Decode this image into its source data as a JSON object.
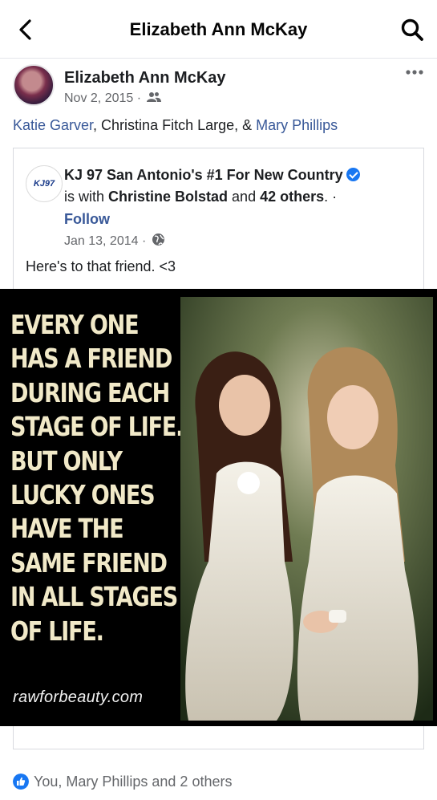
{
  "topbar": {
    "title": "Elizabeth Ann McKay"
  },
  "post": {
    "author": "Elizabeth Ann McKay",
    "date": "Nov 2, 2015 ·",
    "tags": {
      "first": "Katie Garver",
      "middle": ", Christina Fitch Large, & ",
      "last": "Mary Phillips"
    }
  },
  "shared": {
    "logo_text": "KJ97",
    "page_name": "KJ 97 San Antonio's #1 For New Country",
    "with_prefix": "is with ",
    "with_name": "Christine Bolstad",
    "with_and": " and ",
    "with_others": "42 others",
    "with_suffix": ". ·",
    "follow": "Follow",
    "date": "Jan 13, 2014 ·",
    "text": "Here's to that friend.  <3",
    "image": {
      "quote_lines": [
        "EVERY ONE",
        "HAS A FRIEND",
        "DURING EACH",
        "STAGE OF LIFE.",
        "BUT ONLY",
        "LUCKY ONES",
        "HAVE THE",
        "SAME FRIEND",
        "IN ALL STAGES",
        "OF LIFE."
      ],
      "watermark": "rawforbeauty.com"
    }
  },
  "reactions": {
    "text": "You, Mary Phillips and 2 others"
  },
  "colors": {
    "link": "#385898",
    "like": "#1877f2",
    "meta": "#65676b"
  },
  "icons": {
    "back": "chevron-left-icon",
    "search": "search-icon",
    "more": "more-dots-icon",
    "audience": "friends-icon",
    "globe": "globe-icon",
    "verified": "verified-badge-icon",
    "like": "like-icon"
  }
}
